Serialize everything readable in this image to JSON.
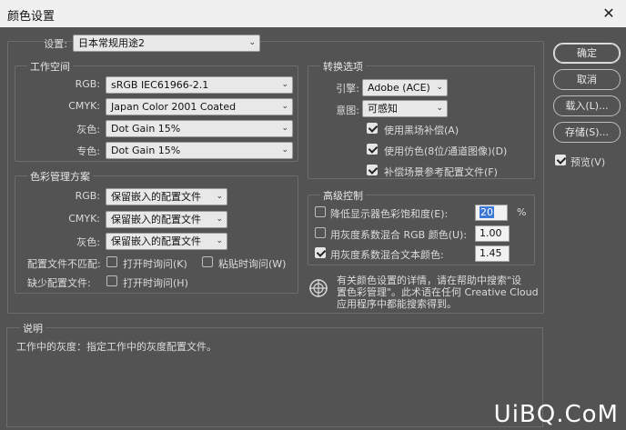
{
  "window": {
    "title": "颜色设置",
    "close_glyph": "✕"
  },
  "settings": {
    "label": "设置:",
    "value": "日本常规用途2"
  },
  "working_spaces": {
    "title": "工作空间",
    "rgb": {
      "label": "RGB:",
      "value": "sRGB IEC61966-2.1"
    },
    "cmyk": {
      "label": "CMYK:",
      "value": "Japan Color 2001 Coated"
    },
    "gray": {
      "label": "灰色:",
      "value": "Dot Gain 15%"
    },
    "spot": {
      "label": "专色:",
      "value": "Dot Gain 15%"
    }
  },
  "color_management": {
    "title": "色彩管理方案",
    "rgb": {
      "label": "RGB:",
      "value": "保留嵌入的配置文件"
    },
    "cmyk": {
      "label": "CMYK:",
      "value": "保留嵌入的配置文件"
    },
    "gray": {
      "label": "灰色:",
      "value": "保留嵌入的配置文件"
    },
    "mismatch_label": "配置文件不匹配:",
    "ask_open": "打开时询问(K)",
    "ask_paste": "粘贴时询问(W)",
    "missing_label": "缺少配置文件:",
    "ask_open_missing": "打开时询问(H)"
  },
  "conversion": {
    "title": "转换选项",
    "engine": {
      "label": "引擎:",
      "value": "Adobe (ACE)"
    },
    "intent": {
      "label": "意图:",
      "value": "可感知"
    },
    "black_point": "使用黑场补偿(A)",
    "dither": "使用仿色(8位/通道图像)(D)",
    "compensate": "补偿场景参考配置文件(F)"
  },
  "advanced": {
    "title": "高级控制",
    "desaturate": {
      "label": "降低显示器色彩饱和度(E):",
      "value": "20",
      "unit": "%"
    },
    "blend_rgb": {
      "label": "用灰度系数混合 RGB 颜色(U):",
      "value": "1.00"
    },
    "blend_text": {
      "label": "用灰度系数混合文本颜色:",
      "value": "1.45"
    }
  },
  "info": {
    "line1": "有关颜色设置的详情，请在帮助中搜索\"设",
    "line2": "置色彩管理\"。此术语在任何 Creative Cloud",
    "line3": "应用程序中都能搜索得到。"
  },
  "description": {
    "title": "说明",
    "text": "工作中的灰度：指定工作中的灰度配置文件。"
  },
  "buttons": {
    "ok": "确定",
    "cancel": "取消",
    "load": "载入(L)...",
    "save": "存储(S)...",
    "preview": "预览(V)"
  },
  "watermark": "UiBQ.CoM"
}
